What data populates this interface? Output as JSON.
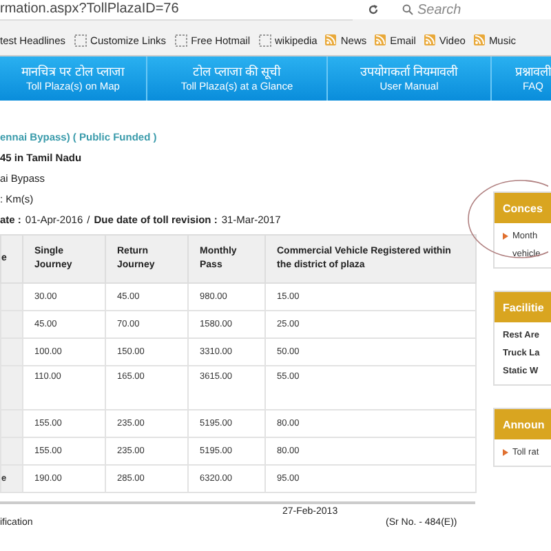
{
  "address_bar": {
    "url": "rmation.aspx?TollPlazaID=76"
  },
  "search": {
    "placeholder": "Search"
  },
  "bookmarks": [
    {
      "label": "test Headlines",
      "kind": "none"
    },
    {
      "label": "Customize Links",
      "kind": "page"
    },
    {
      "label": "Free Hotmail",
      "kind": "page"
    },
    {
      "label": "wikipedia",
      "kind": "page"
    },
    {
      "label": "News",
      "kind": "feed"
    },
    {
      "label": "Email",
      "kind": "feed"
    },
    {
      "label": "Video",
      "kind": "feed"
    },
    {
      "label": "Music",
      "kind": "feed"
    }
  ],
  "nav": [
    {
      "hindi": "मानचित्र पर टोल प्लाजा",
      "english": "Toll Plaza(s) on Map"
    },
    {
      "hindi": "टोल प्लाजा की सूची",
      "english": "Toll Plaza(s) at a Glance"
    },
    {
      "hindi": "उपयोगकर्ता नियमावली",
      "english": "User Manual"
    },
    {
      "hindi": "प्रश्नावली",
      "english": "FAQ"
    }
  ],
  "plaza_title": "ennai Bypass) ( Public Funded )",
  "details": [
    "45 in Tamil Nadu",
    "ai Bypass",
    ": Km(s)"
  ],
  "dates": {
    "label_1": "ate :",
    "value_1": "01-Apr-2016",
    "separator": "/",
    "label_2": "Due date of toll revision :",
    "value_2": "31-Mar-2017"
  },
  "table": {
    "columns": [
      "e",
      "Single Journey",
      "Return Journey",
      "Monthly Pass",
      "Commercial Vehicle Registered within the district of plaza"
    ],
    "rows": [
      {
        "cells": [
          "",
          "30.00",
          "45.00",
          "980.00",
          "15.00"
        ],
        "tall": false
      },
      {
        "cells": [
          "",
          "45.00",
          "70.00",
          "1580.00",
          "25.00"
        ],
        "tall": false
      },
      {
        "cells": [
          "",
          "100.00",
          "150.00",
          "3310.00",
          "50.00"
        ],
        "tall": false
      },
      {
        "cells": [
          "",
          "110.00",
          "165.00",
          "3615.00",
          "55.00"
        ],
        "tall": true
      },
      {
        "cells": [
          "",
          "155.00",
          "235.00",
          "5195.00",
          "80.00"
        ],
        "tall": false
      },
      {
        "cells": [
          "",
          "155.00",
          "235.00",
          "5195.00",
          "80.00"
        ],
        "tall": false
      },
      {
        "cells": [
          "e",
          "190.00",
          "285.00",
          "6320.00",
          "95.00"
        ],
        "tall": false
      }
    ]
  },
  "notification": {
    "label": "ification",
    "date": "27-Feb-2013",
    "serial": "(Sr No. - 484(E))"
  },
  "side_panels": [
    {
      "title": "Conces",
      "kind": "bullets",
      "items": [
        "Month",
        "vehicle"
      ]
    },
    {
      "title": "Facilitie",
      "kind": "plain",
      "items": [
        "Rest Are",
        "Truck La",
        "Static W"
      ]
    },
    {
      "title": "Announ",
      "kind": "bullets",
      "items": [
        "Toll rat"
      ]
    }
  ]
}
